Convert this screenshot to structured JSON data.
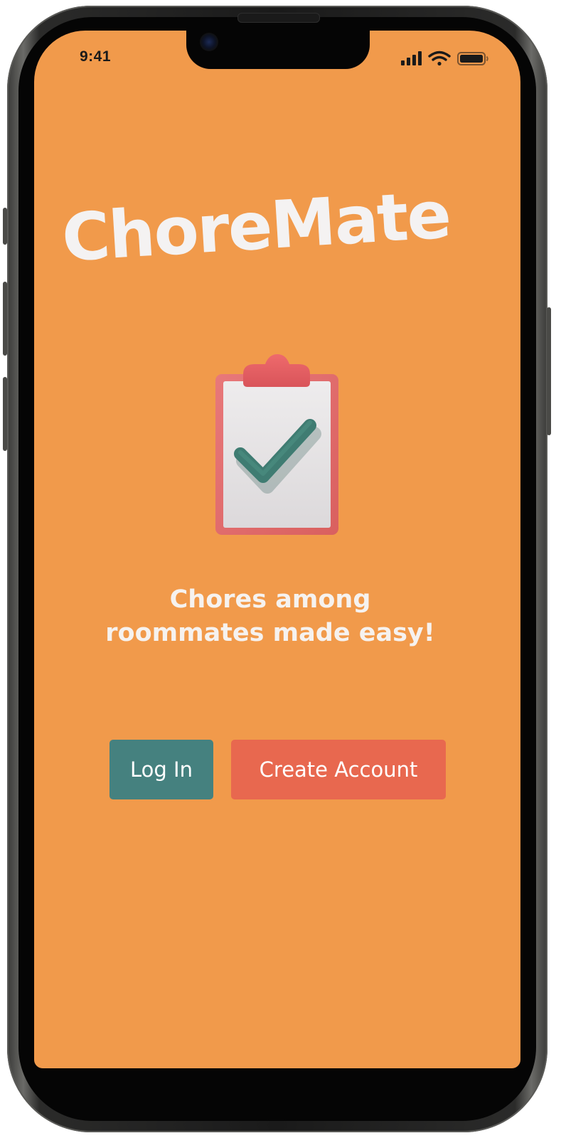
{
  "status_bar": {
    "time": "9:41",
    "icons": [
      "cellular-signal-icon",
      "wifi-icon",
      "battery-icon"
    ]
  },
  "app": {
    "title": "ChoreMate",
    "hero_icon": "clipboard-check-icon",
    "tagline_line1": "Chores among",
    "tagline_line2": "roommates made easy!"
  },
  "actions": {
    "login_label": "Log In",
    "create_account_label": "Create Account"
  },
  "colors": {
    "background": "#f19a4b",
    "login_button": "#45817f",
    "create_account_button": "#e8684f",
    "text": "#f4f2f2"
  }
}
